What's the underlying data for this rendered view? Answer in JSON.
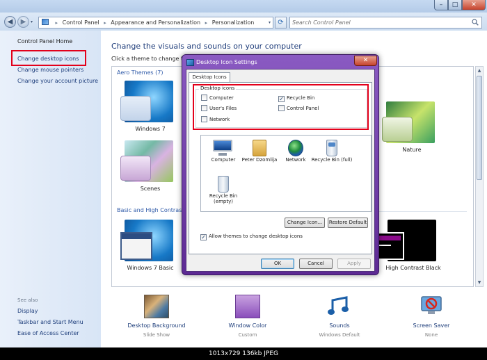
{
  "window": {
    "controls": {
      "minimize": "–",
      "maximize": "□",
      "close": "✕"
    },
    "nav": {
      "back": "◀",
      "forward": "▶",
      "history": "▾"
    },
    "breadcrumb": [
      "Control Panel",
      "Appearance and Personalization",
      "Personalization"
    ],
    "breadcrumb_sep": "▸",
    "search_placeholder": "Search Control Panel"
  },
  "sidebar": {
    "home": "Control Panel Home",
    "links": [
      "Change desktop icons",
      "Change mouse pointers",
      "Change your account picture"
    ],
    "see_also_title": "See also",
    "see_also": [
      "Display",
      "Taskbar and Start Menu",
      "Ease of Access Center"
    ]
  },
  "main": {
    "title": "Change the visuals and sounds on your computer",
    "subtitle": "Click a theme to change the",
    "groups": {
      "aero": "Aero Themes (7)",
      "basic": "Basic and High Contrast T"
    },
    "themes": [
      "Windows 7",
      "Scenes",
      "Nature",
      "Windows 7 Basic",
      "High Contrast Black"
    ],
    "options": [
      {
        "title": "Desktop Background",
        "value": "Slide Show"
      },
      {
        "title": "Window Color",
        "value": "Custom"
      },
      {
        "title": "Sounds",
        "value": "Windows Default"
      },
      {
        "title": "Screen Saver",
        "value": "None"
      }
    ]
  },
  "dialog": {
    "title": "Desktop Icon Settings",
    "close": "✕",
    "tab": "Desktop Icons",
    "legend": "Desktop icons",
    "checkboxes": [
      {
        "label": "Computer",
        "checked": false
      },
      {
        "label": "User's Files",
        "checked": false
      },
      {
        "label": "Network",
        "checked": false
      },
      {
        "label": "Recycle Bin",
        "checked": true
      },
      {
        "label": "Control Panel",
        "checked": false
      }
    ],
    "icons": [
      "Computer",
      "Peter Dzomlija",
      "Network",
      "Recycle Bin (full)",
      "Recycle Bin (empty)"
    ],
    "buttons": {
      "change": "Change Icon...",
      "restore": "Restore Default",
      "ok": "OK",
      "cancel": "Cancel",
      "apply": "Apply"
    },
    "allow_label": "Allow themes to change desktop icons",
    "allow_checked": true,
    "check_mark": "✓"
  },
  "caption": "1013x729  136kb  JPEG",
  "colors": {
    "highlight": "#e3001b",
    "link": "#1e3e7b",
    "dialog_frame": "#6b3aa8"
  }
}
